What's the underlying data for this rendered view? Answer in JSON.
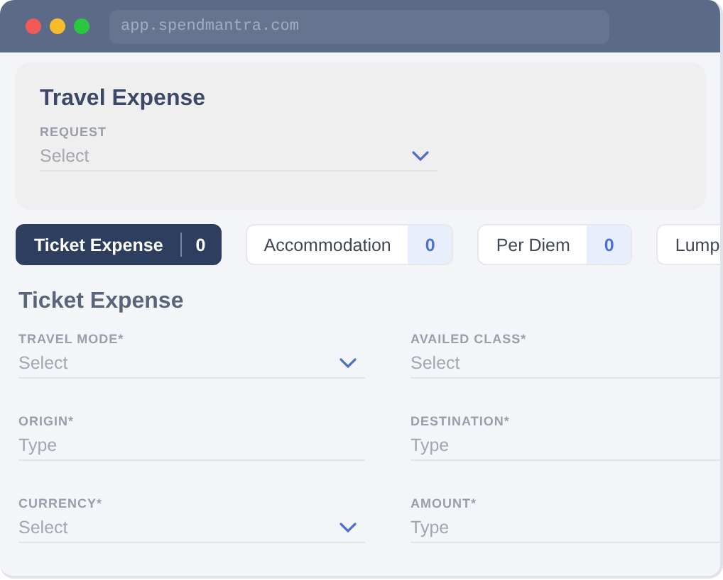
{
  "browser": {
    "address": "app.spendmantra.com"
  },
  "request_panel": {
    "title": "Travel Expense",
    "field": {
      "label": "REQUEST",
      "placeholder": "Select",
      "kind": "select"
    }
  },
  "tabs": [
    {
      "label": "Ticket Expense",
      "count": "0",
      "selected": true
    },
    {
      "label": "Accommodation",
      "count": "0",
      "selected": false
    },
    {
      "label": "Per Diem",
      "count": "0",
      "selected": false
    },
    {
      "label": "Lump",
      "selected": false
    }
  ],
  "section": {
    "title": "Ticket Expense"
  },
  "fields": [
    {
      "label": "TRAVEL MODE*",
      "placeholder": "Select",
      "kind": "select"
    },
    {
      "label": "AVAILED CLASS*",
      "placeholder": "Select",
      "kind": "text"
    },
    {
      "label": "ORIGIN*",
      "placeholder": "Type",
      "kind": "text"
    },
    {
      "label": "DESTINATION*",
      "placeholder": "Type",
      "kind": "text"
    },
    {
      "label": "CURRENCY*",
      "placeholder": "Select",
      "kind": "select"
    },
    {
      "label": "AMOUNT*",
      "placeholder": "Type",
      "kind": "text"
    }
  ]
}
